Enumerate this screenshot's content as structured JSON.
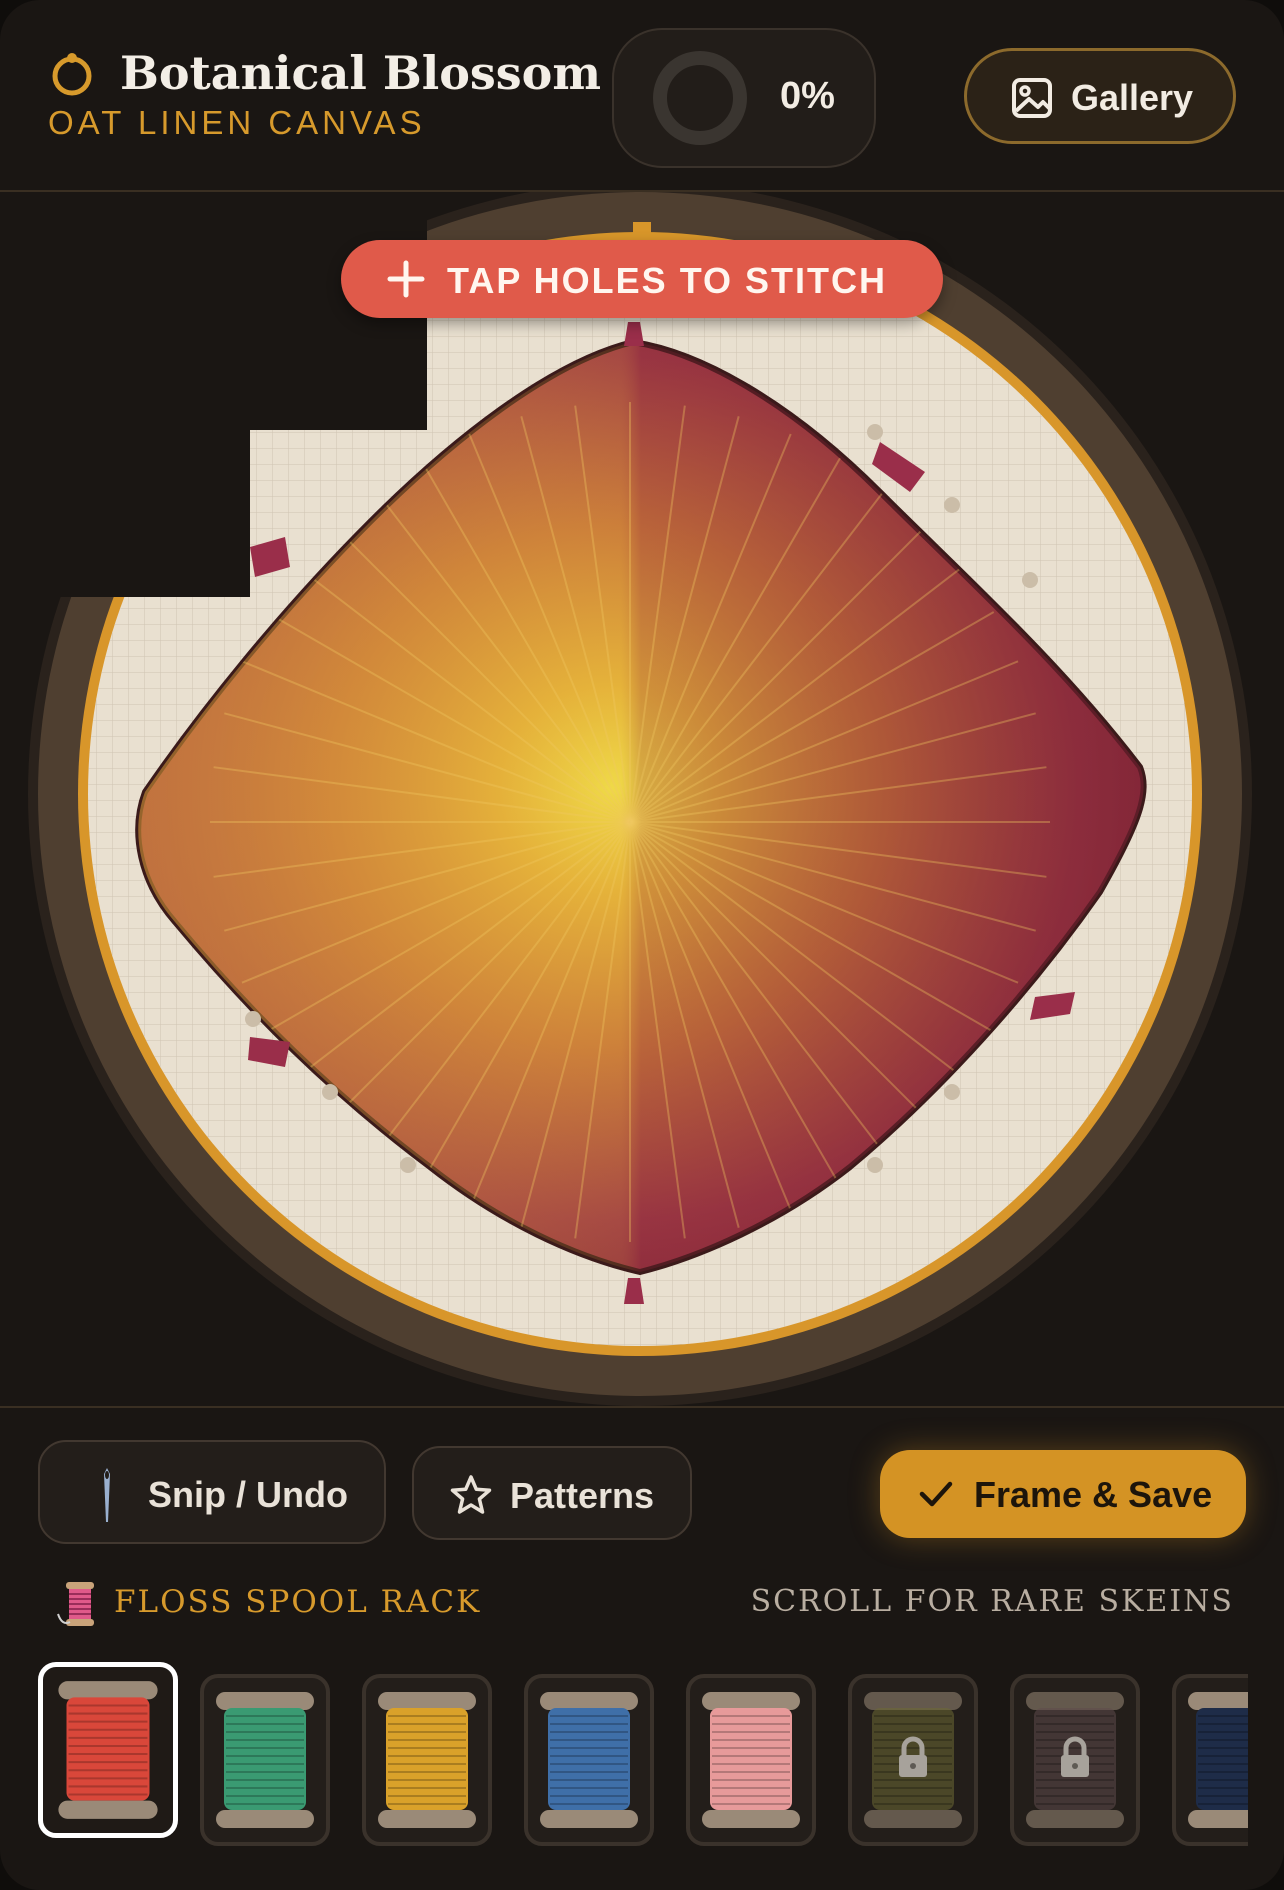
{
  "header": {
    "title": "Botanical Blossom",
    "subtitle": "OAT LINEN CANVAS",
    "progress": 0,
    "progress_label": "0%",
    "gallery_label": "Gallery"
  },
  "hoop": {
    "banner_label": "TAP HOLES TO STITCH"
  },
  "toolbar": {
    "snip_label": "Snip / Undo",
    "patterns_label": "Patterns",
    "frame_label": "Frame & Save"
  },
  "rack": {
    "title": "FLOSS SPOOL RACK",
    "hint": "SCROLL FOR RARE SKEINS",
    "spools": [
      {
        "color": "#d9473a",
        "selected": true,
        "locked": false
      },
      {
        "color": "#3a9a72",
        "selected": false,
        "locked": false
      },
      {
        "color": "#d9a12a",
        "selected": false,
        "locked": false
      },
      {
        "color": "#3f6fa8",
        "selected": false,
        "locked": false
      },
      {
        "color": "#e79a9a",
        "selected": false,
        "locked": false
      },
      {
        "color": "#6d6a34",
        "selected": false,
        "locked": true
      },
      {
        "color": "#5e4a4c",
        "selected": false,
        "locked": true
      },
      {
        "color": "#1e2c48",
        "selected": false,
        "locked": false
      }
    ]
  },
  "colors": {
    "accent": "#d79a2c",
    "banner": "#e05a4a",
    "hoop_wood": "#4f3f30",
    "hoop_ring": "#d8962a",
    "canvas": "#e9e0d0"
  }
}
